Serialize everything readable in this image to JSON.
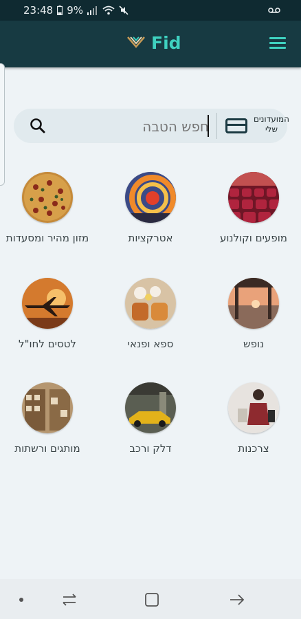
{
  "status_bar": {
    "time": "23:48",
    "battery": "9%",
    "voicemail_icon": "voicemail-icon"
  },
  "app_bar": {
    "logo_text": "Fid",
    "menu_icon": "hamburger-menu-icon"
  },
  "search": {
    "placeholder": "חפש הטבה",
    "clubs_label": "המועדונים שלי"
  },
  "categories": [
    {
      "label": "מופעים וקולנוע",
      "image": "theater-seats",
      "color": "#9b1f3a"
    },
    {
      "label": "אטרקציות",
      "image": "ferris-wheel",
      "color": "#e0652a"
    },
    {
      "label": "מזון מהיר ומסעדות",
      "image": "pizza",
      "color": "#b5542a"
    },
    {
      "label": "נופש",
      "image": "sunset-pier",
      "color": "#c07a55"
    },
    {
      "label": "ספא ופנאי",
      "image": "spa-towels",
      "color": "#c9a06e"
    },
    {
      "label": "לטסים לחו\"ל",
      "image": "airplane-sunset",
      "color": "#d0772b"
    },
    {
      "label": "צרכנות",
      "image": "shopping-woman",
      "color": "#8e2a2f"
    },
    {
      "label": "דלק ורכב",
      "image": "gas-station-car",
      "color": "#6a6f5a"
    },
    {
      "label": "מותגים ורשתות",
      "image": "store-shelves",
      "color": "#9a7a55"
    }
  ],
  "colors": {
    "appbar": "#173a42",
    "accent": "#3fd1c0",
    "background": "#eef3f6"
  }
}
